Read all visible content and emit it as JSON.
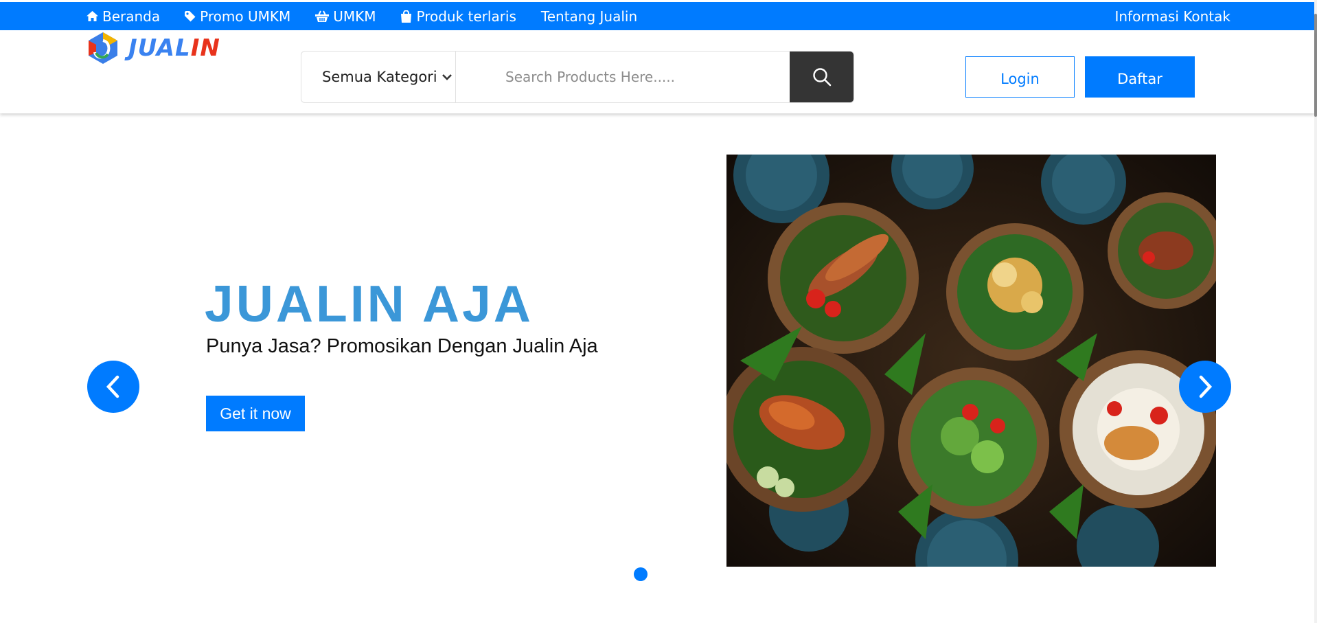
{
  "topbar": {
    "nav": [
      {
        "label": "Beranda",
        "icon": "home-icon"
      },
      {
        "label": "Promo UMKM",
        "icon": "tag-icon"
      },
      {
        "label": "UMKM",
        "icon": "basket-icon"
      },
      {
        "label": "Produk terlaris",
        "icon": "shopping-bag-icon"
      },
      {
        "label": "Tentang Jualin",
        "icon": ""
      }
    ],
    "contact": "Informasi Kontak"
  },
  "header": {
    "logo_text_part1": "JUAL",
    "logo_text_part2": "IN",
    "category_label": "Semua Kategori",
    "search_placeholder": "Search Products Here.....",
    "login_label": "Login",
    "register_label": "Daftar"
  },
  "hero": {
    "title": "JUALIN AJA",
    "subtitle": "Punya Jasa? Promosikan Dengan Jualin Aja",
    "cta_label": "Get it now",
    "slide_image": "indonesian-food-platter",
    "active_slide": 1,
    "slide_count": 1
  },
  "colors": {
    "primary": "#007bff",
    "hero_title": "#3b97d8",
    "search_button": "#343434"
  }
}
